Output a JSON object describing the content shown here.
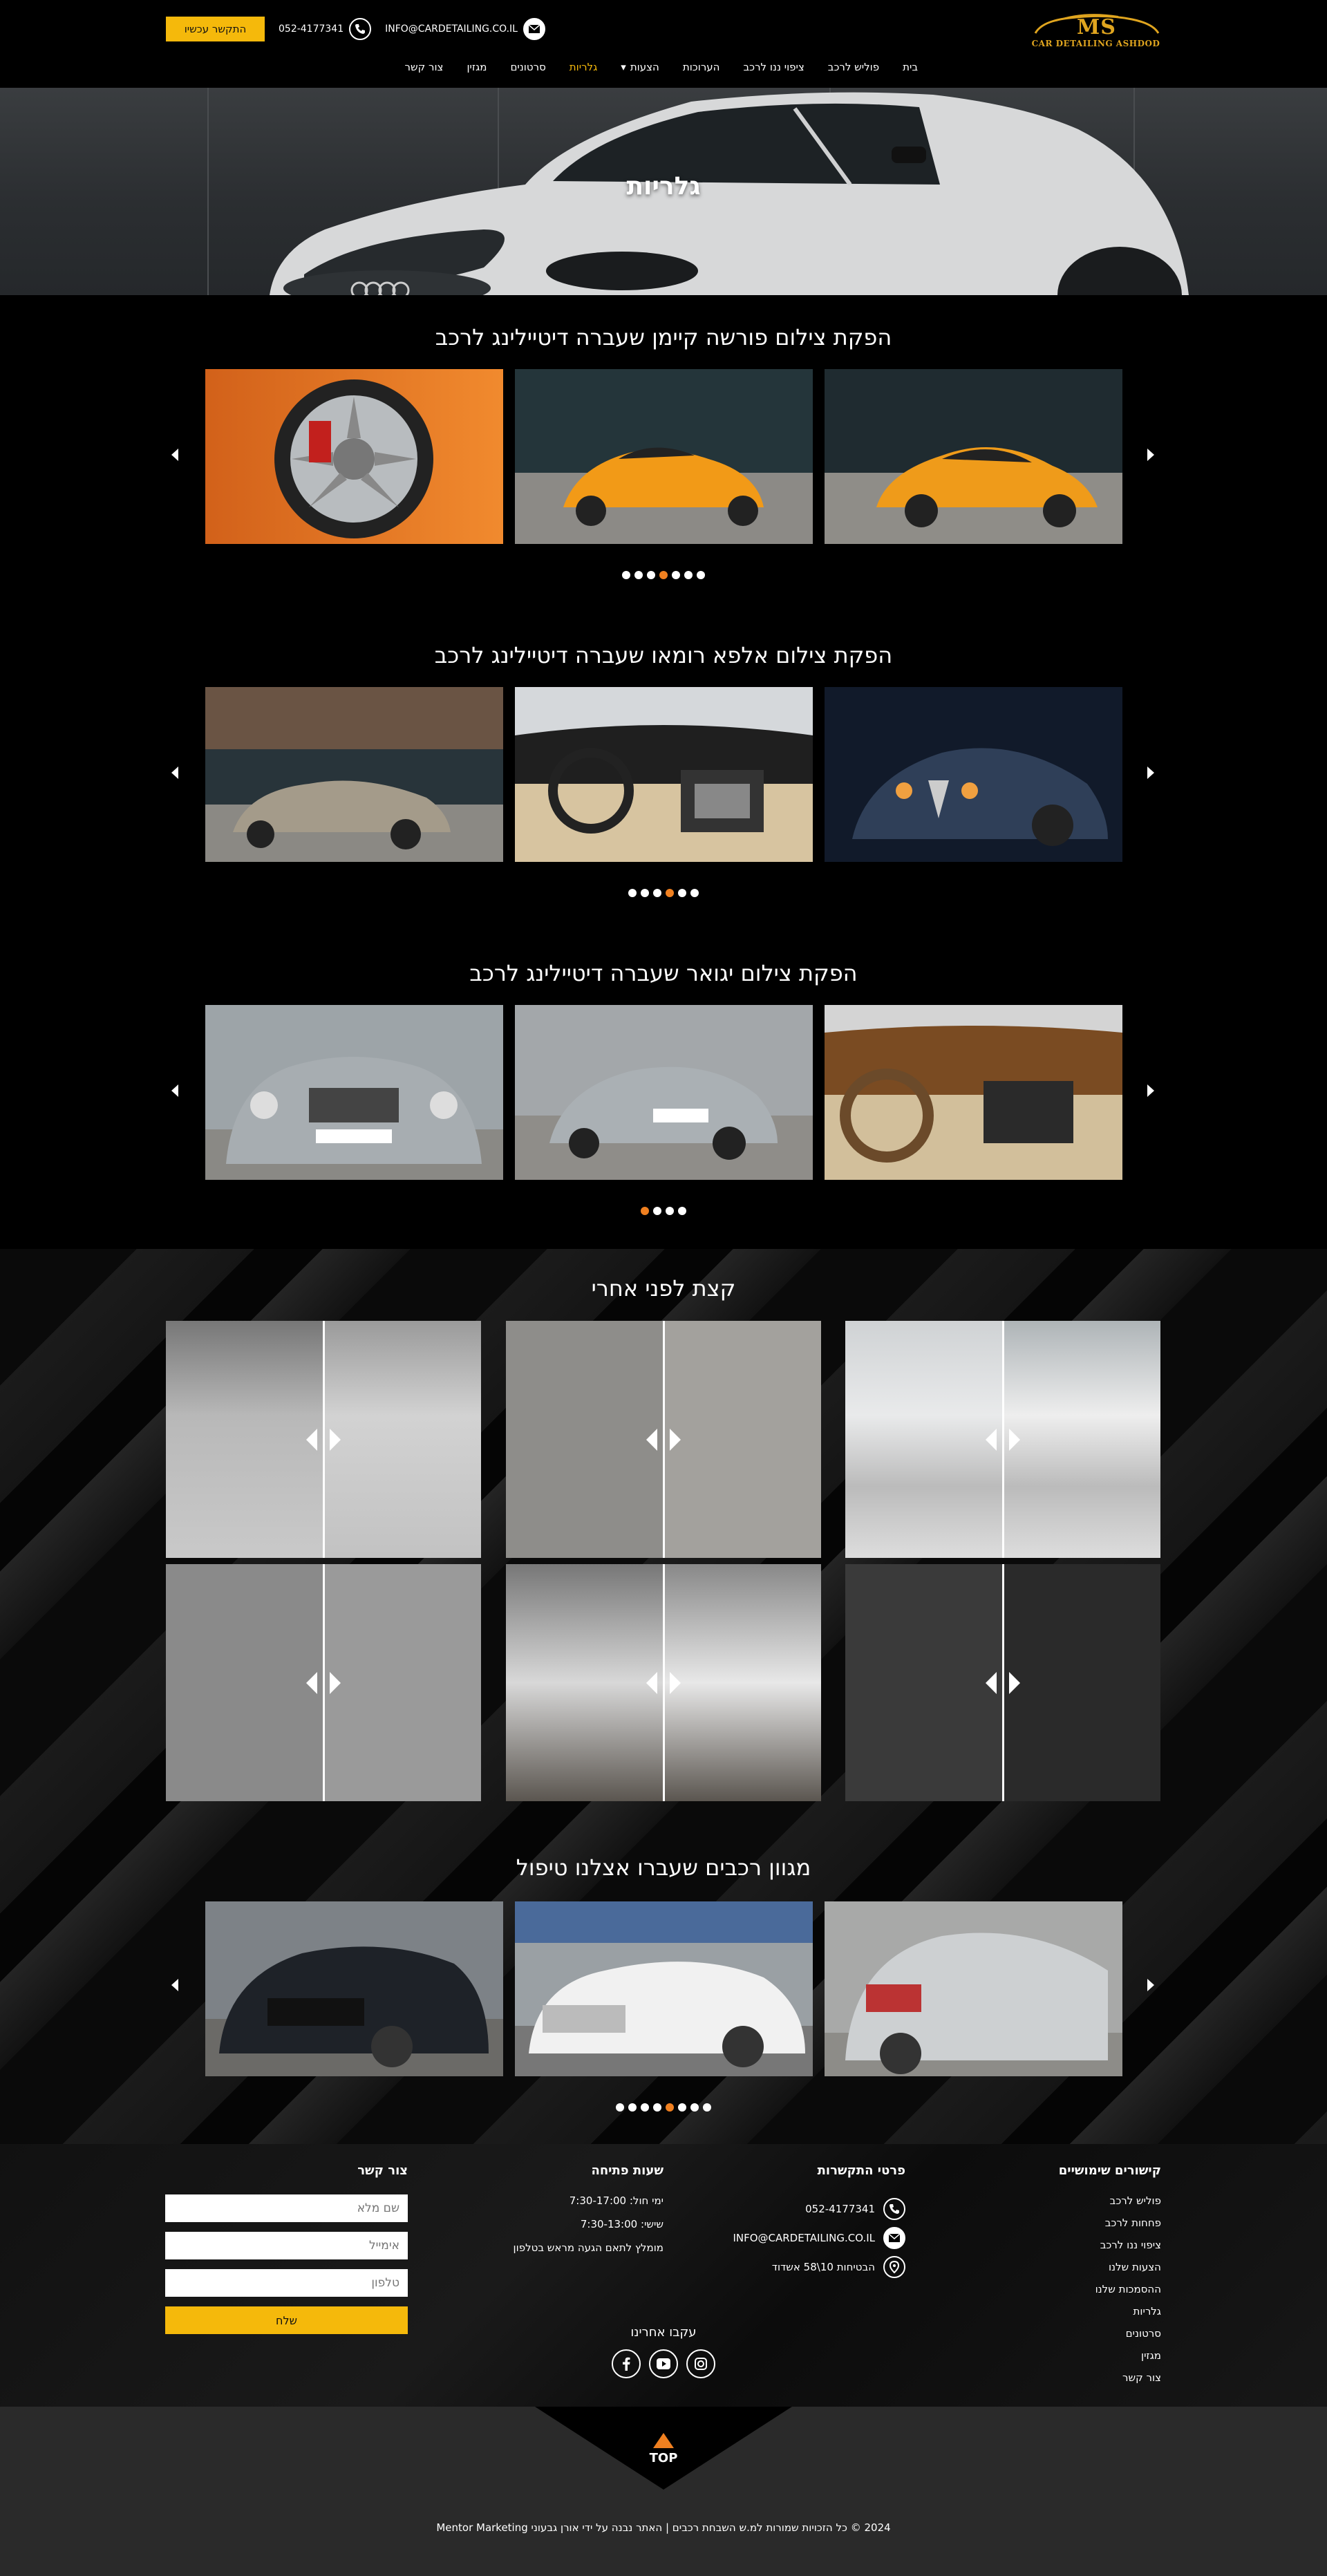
{
  "header": {
    "logo": {
      "mark": "MS",
      "tagline": "CAR DETAILING ASHDOD"
    },
    "order_button": "התקשר עכשיו",
    "phone": "052-4177341",
    "email": "INFO@CARDETAILING.CO.IL",
    "nav": [
      {
        "label": "בית"
      },
      {
        "label": "פוליש לרכב"
      },
      {
        "label": "ציפוי ננו לרכב"
      },
      {
        "label": "הערוכות"
      },
      {
        "label": "הצעות",
        "has_dropdown": true
      },
      {
        "label": "גלריות",
        "active": true
      },
      {
        "label": "סרטונים"
      },
      {
        "label": "מגזין"
      },
      {
        "label": "צור קשר"
      }
    ]
  },
  "hero": {
    "title": "גלריות"
  },
  "galleries": [
    {
      "title": "הפקת צילום פורשה קיימן שעברה דיטיילינג לרכב",
      "dots": 7,
      "active_dot": 3
    },
    {
      "title": "הפקת צילום אלפא רומאו שעברה דיטיילינג לרכב",
      "dots": 6,
      "active_dot": 3
    },
    {
      "title": "הפקת צילום יגואר שעברה דיטיילינג לרכב",
      "dots": 4,
      "active_dot": 0
    }
  ],
  "before_after": {
    "title": "קצת לפני אחרי"
  },
  "cars": {
    "title": "מגוון רכבים שעברו אצלנו טיפול",
    "dots": 8,
    "active_dot": 4
  },
  "footer": {
    "links_title": "קישורים שימושיים",
    "links": [
      "פוליש לרכב",
      "פחחות לרכב",
      "ציפוי ננו לרכב",
      "הצעות שלנו",
      "ההסמכות שלנו",
      "גלריות",
      "סרטונים",
      "מגזין",
      "צור קשר"
    ],
    "contact_title": "פרטי התקשרות",
    "contact_phone": "052-4177341",
    "contact_email": "INFO@CARDETAILING.CO.IL",
    "contact_address": "הבטיחות 10\\58 אשדוד",
    "hours_title": "שעות פתיחה",
    "hours": [
      "ימי חול: 7:30-17:00",
      "שישי: 7:30-13:00",
      "מומלץ לתאם הגעה מראש בטלפון"
    ],
    "form_title": "צור קשר",
    "form": {
      "name_placeholder": "שם מלא",
      "email_placeholder": "אימייל",
      "phone_placeholder": "טלפון",
      "submit": "שלח"
    },
    "follow_title": "עקבו אחרינו",
    "top_label": "TOP",
    "copyright": "2024 © כל הזכויות שמורות למ.ש השבחת רכבים | האתר נבנה על ידי אורן גבעוני Mentor Marketing"
  },
  "colors": {
    "accent": "#f5b90b",
    "active_dot": "#f08020",
    "background": "#000000"
  }
}
